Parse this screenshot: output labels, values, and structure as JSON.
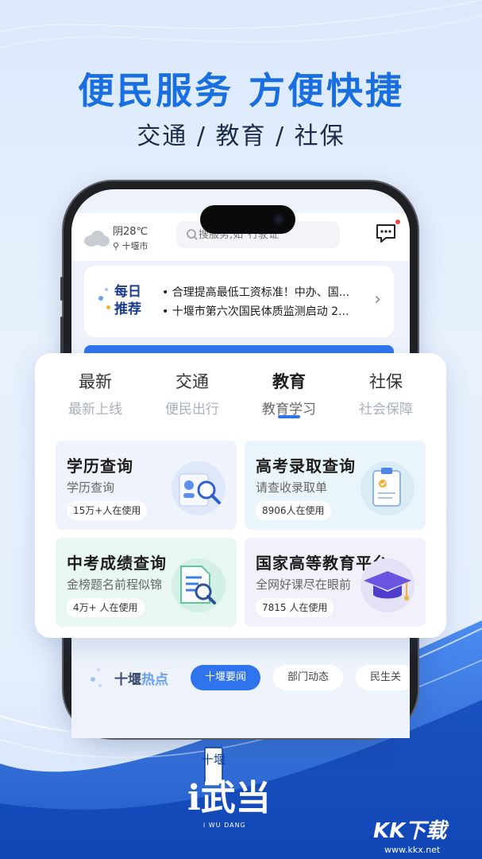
{
  "headline": "便民服务 方便快捷",
  "subline": "交通 / 教育 / 社保",
  "phone": {
    "weather": {
      "temp": "阴28℃",
      "city": "十堰市",
      "icon": "cloud-icon"
    },
    "search": {
      "placeholder": "搜服务,如\"行驶证\""
    },
    "message_icon": "message-icon",
    "daily": {
      "badge_line1": "每日",
      "badge_line2": "推荐",
      "news": [
        "合理提高最低工资标准！中办、国...",
        "十堰市第六次国民体质监测启动 2..."
      ]
    },
    "hot": {
      "title_a": "十堰",
      "title_b": "热点",
      "pills": [
        "十堰要闻",
        "部门动态",
        "民生关"
      ]
    }
  },
  "card": {
    "tabs": [
      {
        "label": "最新",
        "sub": "最新上线"
      },
      {
        "label": "交通",
        "sub": "便民出行"
      },
      {
        "label": "教育",
        "sub": "教育学习",
        "active": true
      },
      {
        "label": "社保",
        "sub": "社会保障"
      }
    ],
    "services": [
      {
        "title": "学历查询",
        "desc": "学历查询",
        "usage": "15万+人在使用",
        "bg": "#eef3fc"
      },
      {
        "title": "高考录取查询",
        "desc": "请查收录取单",
        "usage": "8906人在使用",
        "bg": "#eaf5fb"
      },
      {
        "title": "中考成绩查询",
        "desc": "金榜题名前程似锦",
        "usage": "4万+ 人在使用",
        "bg": "#e9f7f3"
      },
      {
        "title": "国家高等教育平台",
        "desc": "全网好课尽在眼前",
        "usage": "7815 人在使用",
        "bg": "#f1f0fb"
      }
    ]
  },
  "brand": {
    "logo_top": "十堰",
    "logo_main": "i武当",
    "logo_sub": "i WU DANG"
  },
  "watermark": {
    "text": "KK下载",
    "url": "www.kkx.net"
  },
  "colors": {
    "accent": "#2f74ec",
    "headline": "#1a6fe0"
  }
}
